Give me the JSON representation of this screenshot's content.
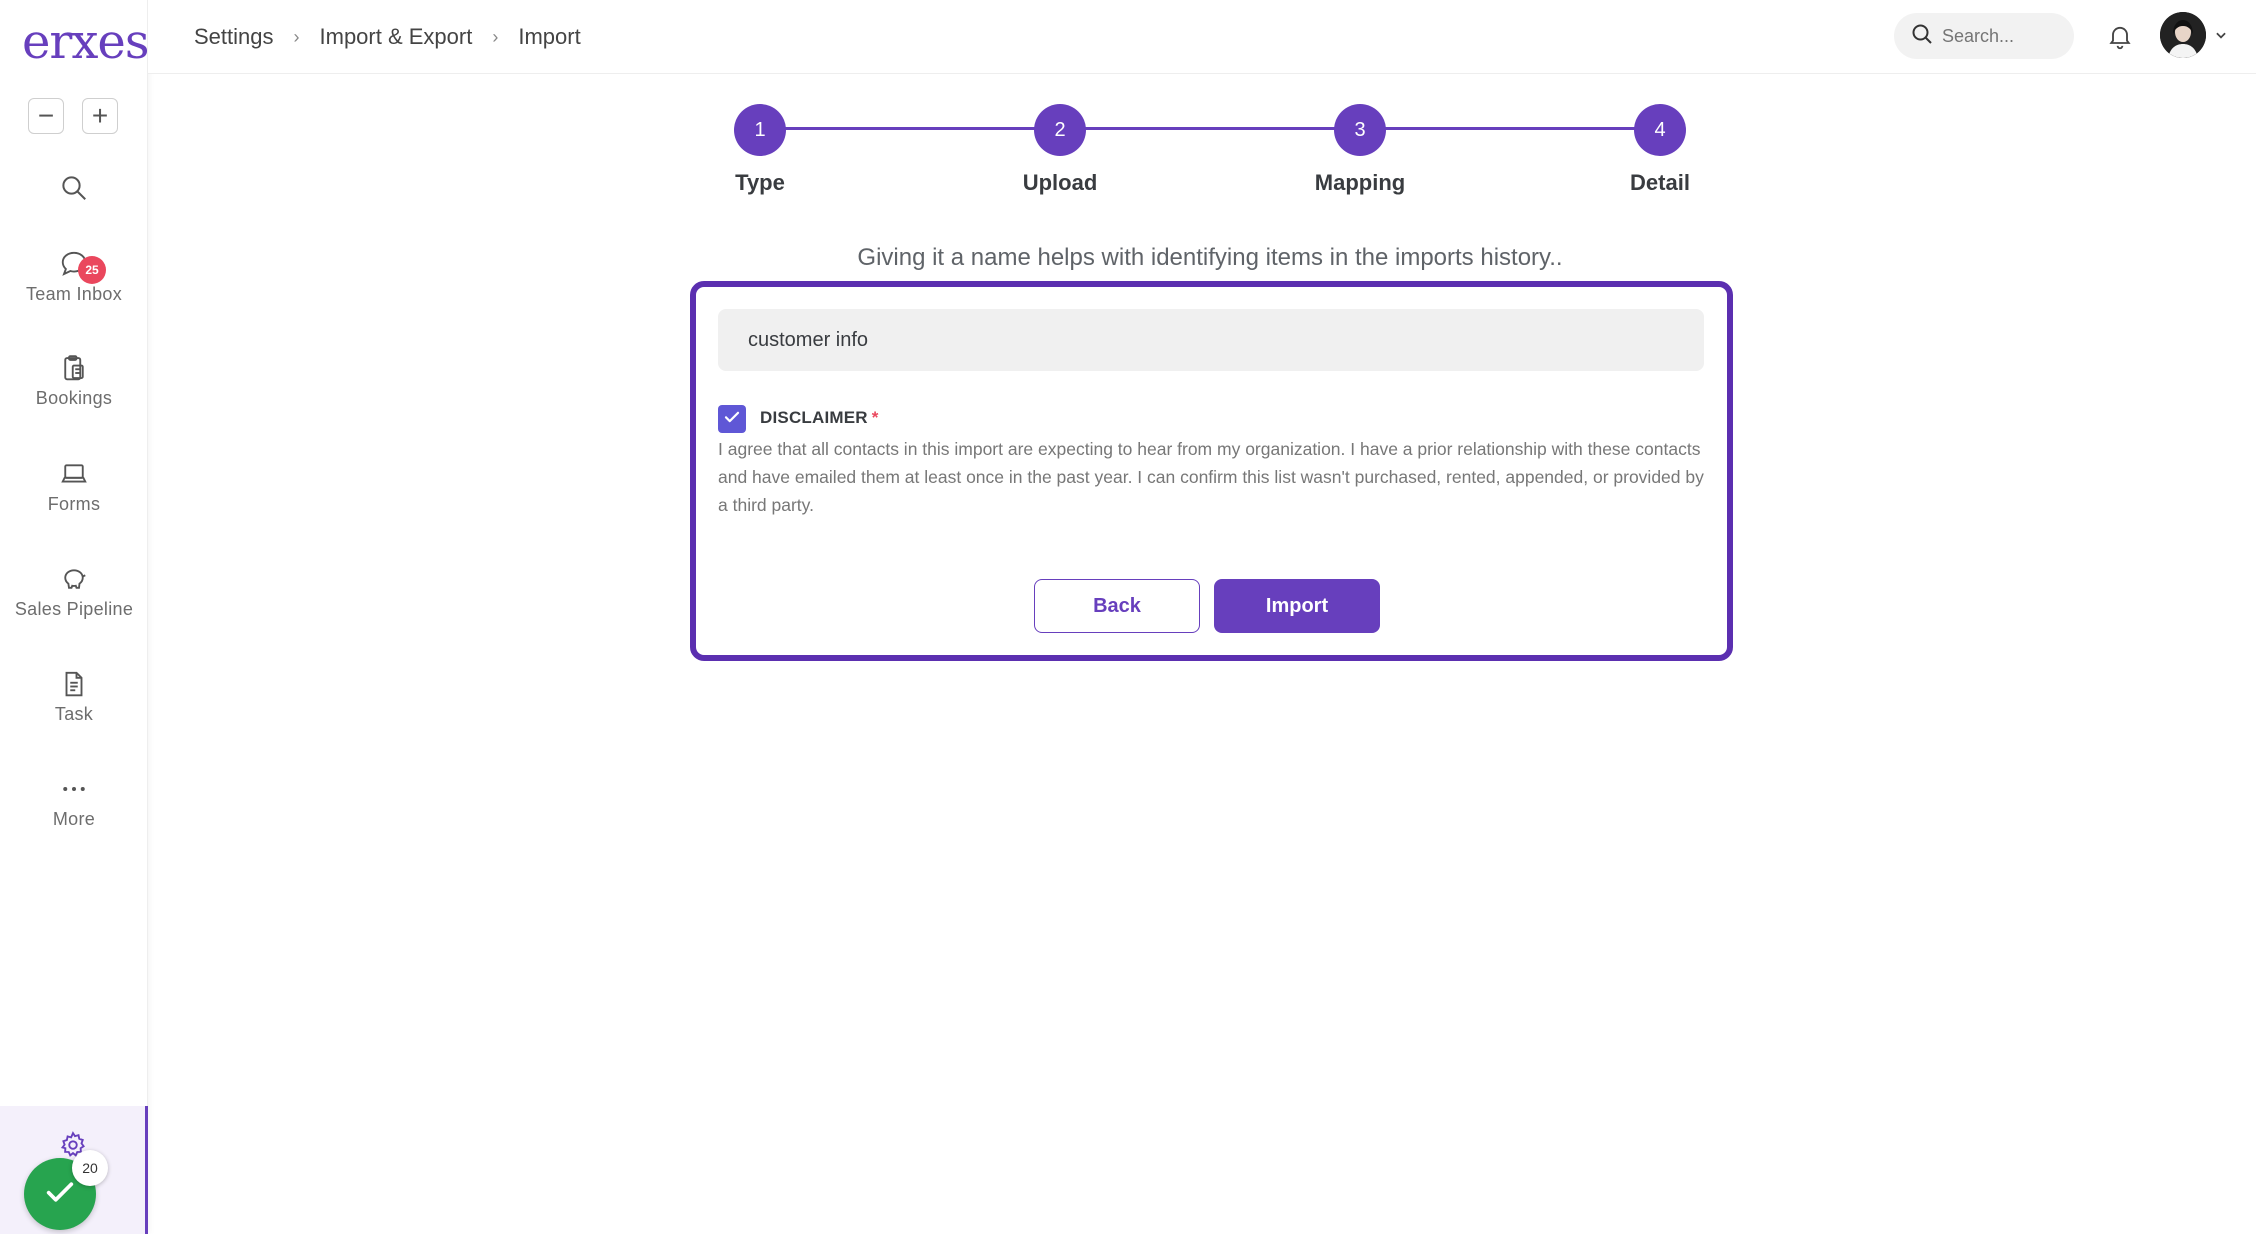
{
  "brand": {
    "logo_text": "erxes",
    "accent": "#673fbd"
  },
  "sidebar": {
    "zoom_out": "−",
    "zoom_in": "+",
    "items": [
      {
        "id": "search",
        "label": "",
        "icon": "search-icon"
      },
      {
        "id": "team-inbox",
        "label": "Team Inbox",
        "icon": "chat-icon",
        "badge": "25"
      },
      {
        "id": "bookings",
        "label": "Bookings",
        "icon": "clipboard-icon"
      },
      {
        "id": "forms",
        "label": "Forms",
        "icon": "laptop-icon"
      },
      {
        "id": "sales-pipeline",
        "label": "Sales Pipeline",
        "icon": "piggy-bank-icon"
      },
      {
        "id": "task",
        "label": "Task",
        "icon": "file-icon"
      },
      {
        "id": "more",
        "label": "More",
        "icon": "more-icon"
      }
    ],
    "settings_badge": "20"
  },
  "header": {
    "breadcrumb": [
      "Settings",
      "Import & Export",
      "Import"
    ],
    "search_placeholder": "Search..."
  },
  "stepper": {
    "steps": [
      {
        "number": "1",
        "label": "Type"
      },
      {
        "number": "2",
        "label": "Upload"
      },
      {
        "number": "3",
        "label": "Mapping"
      },
      {
        "number": "4",
        "label": "Detail"
      }
    ]
  },
  "form": {
    "hint": "Giving it a name helps with identifying items in the imports history..",
    "name_value": "customer info",
    "disclaimer_title": "DISCLAIMER",
    "required_mark": "*",
    "disclaimer_text": "I agree that all contacts in this import are expecting to hear from my organization. I have a prior relationship with these contacts and have emailed them at least once in the past year. I can confirm this list wasn't purchased, rented, appended, or provided by a third party.",
    "checked": true,
    "back_label": "Back",
    "import_label": "Import"
  }
}
